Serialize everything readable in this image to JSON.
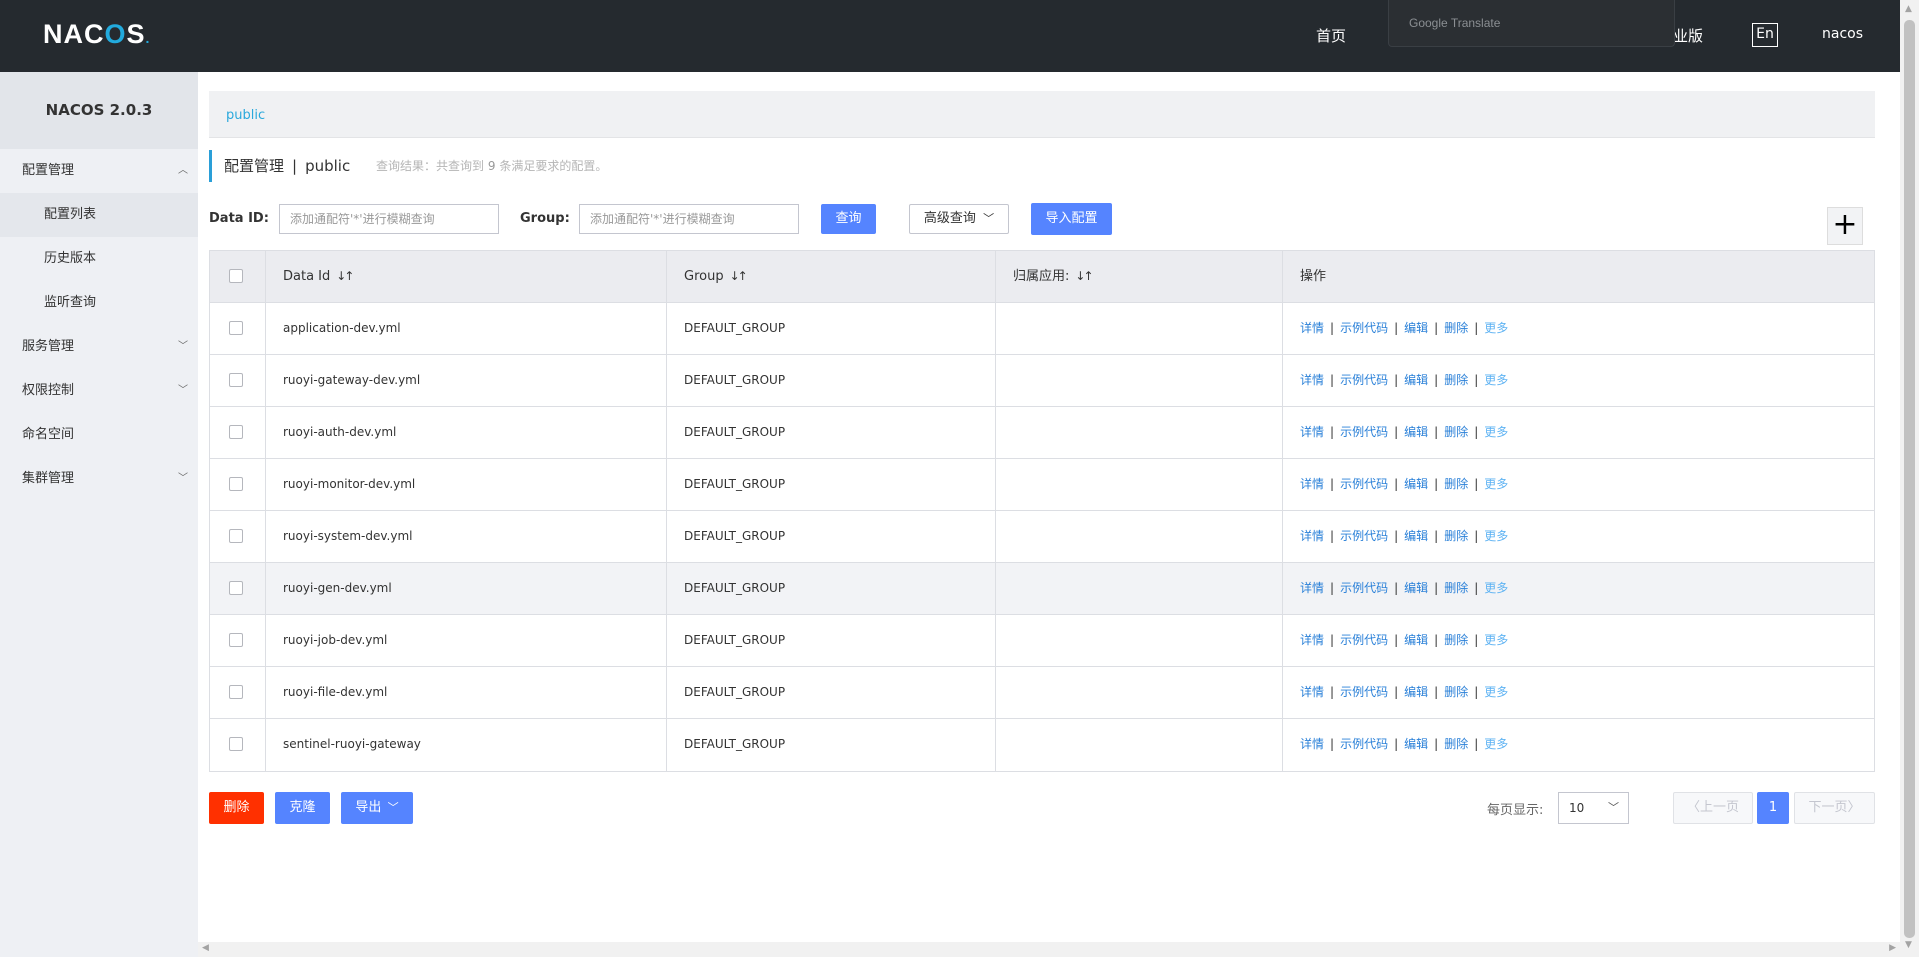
{
  "header": {
    "logo": {
      "pre": "NAC",
      "o": "O",
      "post": "S",
      "dot": "."
    },
    "nav_home": "首页",
    "google_translate": "Google Translate",
    "enterprise": "企业版",
    "lang": "En",
    "user": "nacos"
  },
  "sidebar": {
    "version": "NACOS 2.0.3",
    "items": [
      {
        "label": "配置管理",
        "chevron": "up"
      },
      {
        "label": "配置列表"
      },
      {
        "label": "历史版本"
      },
      {
        "label": "监听查询"
      },
      {
        "label": "服务管理",
        "chevron": "down"
      },
      {
        "label": "权限控制",
        "chevron": "down"
      },
      {
        "label": "命名空间"
      },
      {
        "label": "集群管理",
        "chevron": "down"
      }
    ]
  },
  "breadcrumb": "public",
  "page": {
    "title": "配置管理",
    "separator": "|",
    "namespace": "public",
    "result_prefix": "查询结果：共查询到",
    "result_count": "9",
    "result_suffix": "条满足要求的配置。"
  },
  "search": {
    "dataid_label": "Data ID:",
    "dataid_placeholder": "添加通配符'*'进行模糊查询",
    "group_label": "Group:",
    "group_placeholder": "添加通配符'*'进行模糊查询",
    "query_button": "查询",
    "advanced_button": "高级查询",
    "import_button": "导入配置",
    "add_button": "+"
  },
  "table": {
    "columns": [
      "Data Id",
      "Group",
      "归属应用:",
      "操作"
    ],
    "sort_glyph": "↓↑",
    "ops": [
      "详情",
      "示例代码",
      "编辑",
      "删除",
      "更多"
    ],
    "rows": [
      {
        "data_id": "application-dev.yml",
        "group": "DEFAULT_GROUP",
        "app": ""
      },
      {
        "data_id": "ruoyi-gateway-dev.yml",
        "group": "DEFAULT_GROUP",
        "app": ""
      },
      {
        "data_id": "ruoyi-auth-dev.yml",
        "group": "DEFAULT_GROUP",
        "app": ""
      },
      {
        "data_id": "ruoyi-monitor-dev.yml",
        "group": "DEFAULT_GROUP",
        "app": ""
      },
      {
        "data_id": "ruoyi-system-dev.yml",
        "group": "DEFAULT_GROUP",
        "app": ""
      },
      {
        "data_id": "ruoyi-gen-dev.yml",
        "group": "DEFAULT_GROUP",
        "app": ""
      },
      {
        "data_id": "ruoyi-job-dev.yml",
        "group": "DEFAULT_GROUP",
        "app": ""
      },
      {
        "data_id": "ruoyi-file-dev.yml",
        "group": "DEFAULT_GROUP",
        "app": ""
      },
      {
        "data_id": "sentinel-ruoyi-gateway",
        "group": "DEFAULT_GROUP",
        "app": ""
      }
    ]
  },
  "actions": {
    "delete": "删除",
    "clone": "克隆",
    "export": "导出"
  },
  "pagination": {
    "per_page_label": "每页显示:",
    "per_page_value": "10",
    "prev": "上一页",
    "current": "1",
    "next": "下一页"
  },
  "colors": {
    "topbar": "#252a2f",
    "primary": "#5584ff",
    "danger": "#ff3000",
    "link": "#2a80d8",
    "accent": "#2aa9dc"
  }
}
